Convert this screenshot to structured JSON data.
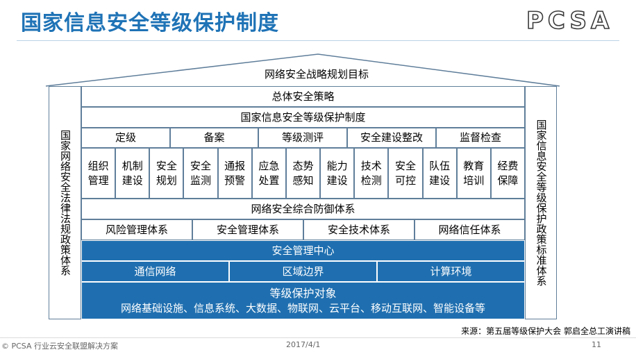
{
  "header": {
    "title": "国家信息安全等级保护制度",
    "logo": "PCSA"
  },
  "diagram": {
    "roof_label": "网络安全战略规划目标",
    "left_pillar": "国家网络安全法律法规政策体系",
    "right_pillar": "国家信息安全等级保护政策标准体系",
    "strategy": "总体安全策略",
    "system": "国家信息安全等级保护制度",
    "stages": [
      "定级",
      "备案",
      "等级测评",
      "安全建设整改",
      "监督检查"
    ],
    "measures": [
      "组织\n管理",
      "机制\n建设",
      "安全\n规划",
      "安全\n监测",
      "通报\n预警",
      "应急\n处置",
      "态势\n感知",
      "能力\n建设",
      "技术\n检测",
      "安全\n可控",
      "队伍\n建设",
      "教育\n培训",
      "经费\n保障"
    ],
    "defense": "网络安全综合防御体系",
    "defense_systems": [
      "风险管理体系",
      "安全管理体系",
      "安全技术体系",
      "网络信任体系"
    ],
    "mgmt_center": "安全管理中心",
    "zones": [
      "通信网络",
      "区域边界",
      "计算环境"
    ],
    "objects_title": "等级保护对象",
    "objects_list": "网络基础设施、信息系统、大数据、物联网、云平台、移动互联网、智能设备等"
  },
  "source": "来源：第五届等级保护大会 郭启全总工演讲稿",
  "footer": {
    "copyright": "© PCSA 行业云安全联盟解决方案",
    "date": "2017/4/1",
    "page": "11"
  },
  "colors": {
    "title": "#1f73b6",
    "blue_fill": "#1f6fb0",
    "border": "#5f7e9a"
  }
}
